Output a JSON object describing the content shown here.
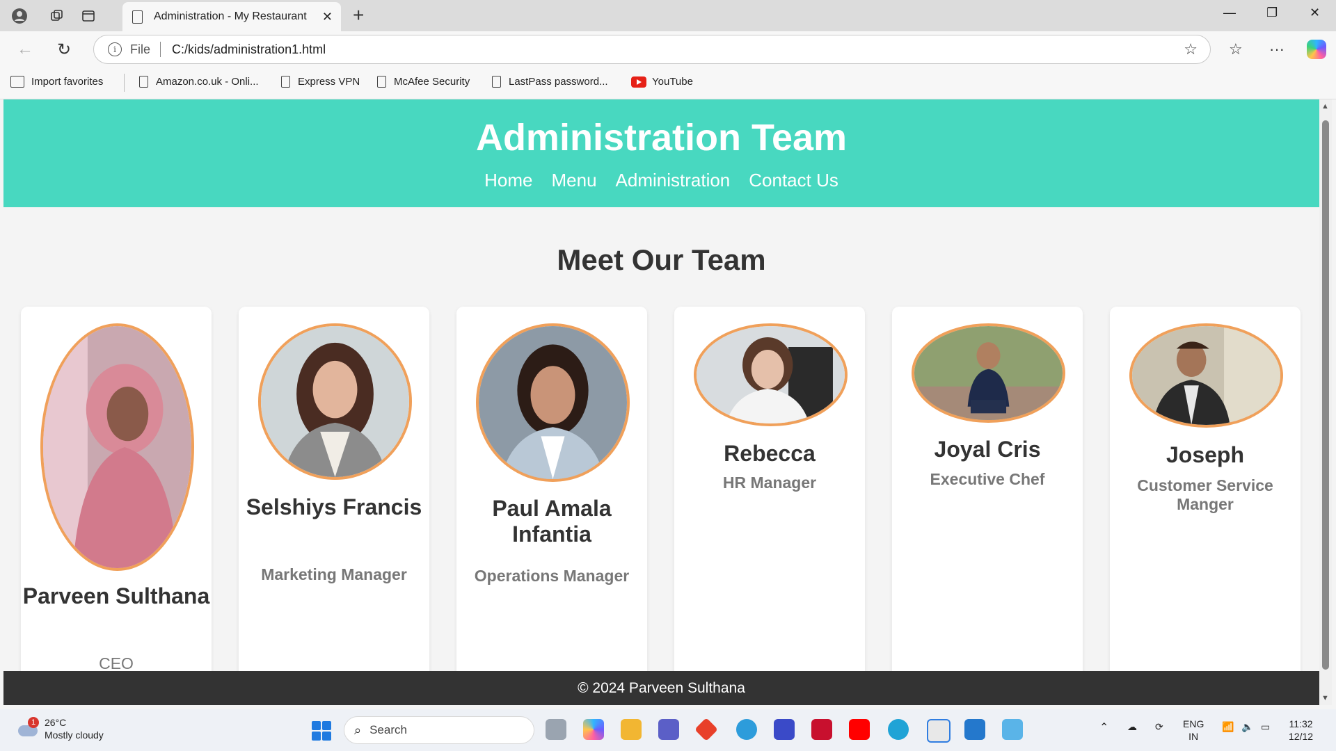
{
  "browser": {
    "tab_title": "Administration - My Restaurant",
    "address_label": "File",
    "address_url": "C:/kids/administration1.html",
    "favorites": [
      {
        "label": "Import favorites"
      },
      {
        "label": "Amazon.co.uk - Onli..."
      },
      {
        "label": "Express VPN"
      },
      {
        "label": "McAfee Security"
      },
      {
        "label": "LastPass password..."
      },
      {
        "label": "YouTube"
      }
    ]
  },
  "site": {
    "title": "Administration Team",
    "nav": [
      "Home",
      "Menu",
      "Administration",
      "Contact Us"
    ],
    "section_title": "Meet Our Team",
    "team": [
      {
        "name": "Parveen Sulthana",
        "role": "CEO"
      },
      {
        "name": "Selshiys Francis",
        "role": "Marketing Manager"
      },
      {
        "name": "Paul Amala Infantia",
        "role": "Operations Manager"
      },
      {
        "name": "Rebecca",
        "role": "HR Manager"
      },
      {
        "name": "Joyal Cris",
        "role": "Executive Chef"
      },
      {
        "name": "Joseph",
        "role": "Customer Service Manger"
      }
    ],
    "footer": "© 2024 Parveen Sulthana"
  },
  "taskbar": {
    "weather_badge": "1",
    "temperature": "26°C",
    "condition": "Mostly cloudy",
    "search_placeholder": "Search",
    "lang_top": "ENG",
    "lang_bottom": "IN",
    "time": "11:32",
    "date": "12/12"
  },
  "colors": {
    "header": "#48d8c0",
    "photo_border": "#f0a05a",
    "footer": "#333333"
  }
}
